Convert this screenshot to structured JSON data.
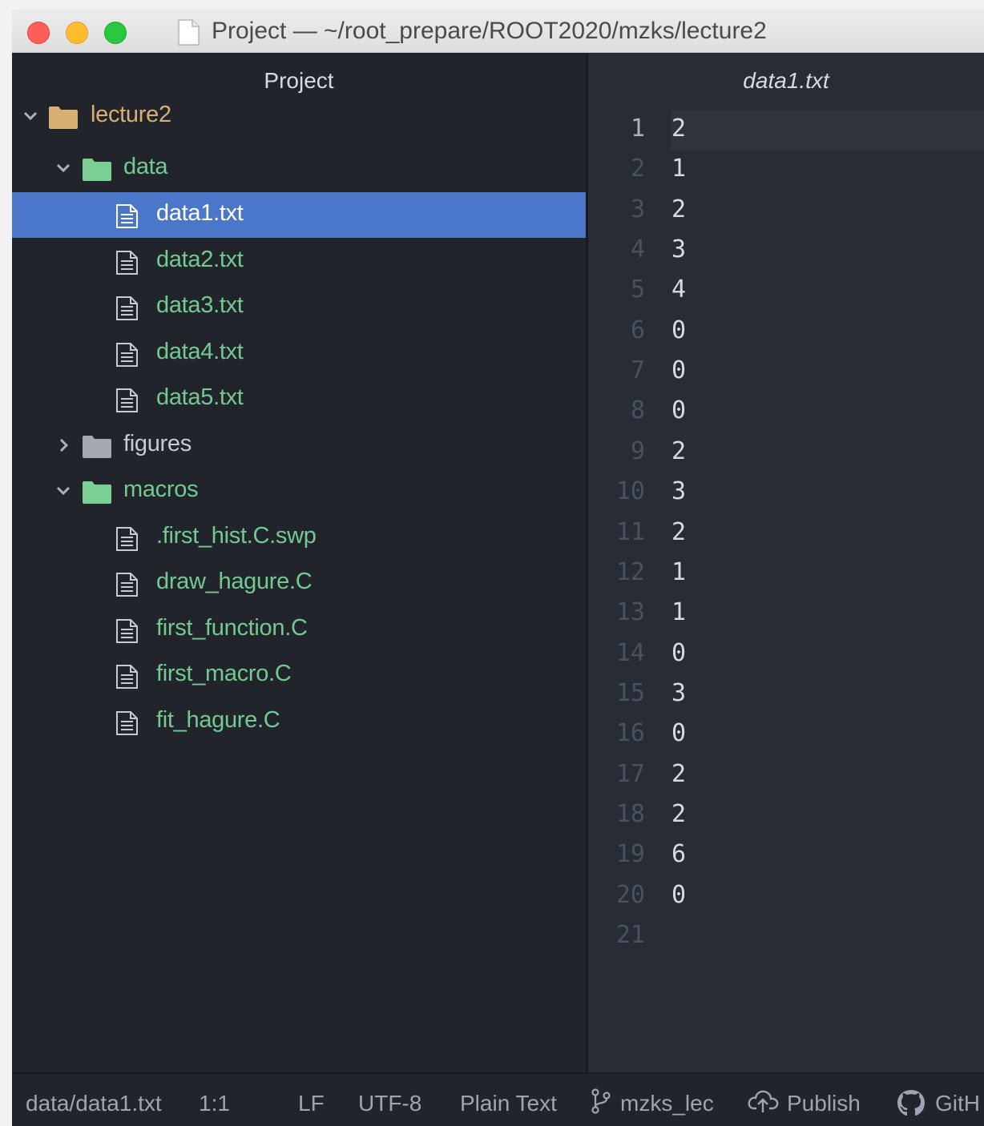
{
  "window": {
    "title": "Project — ~/root_prepare/ROOT2020/mzks/lecture2"
  },
  "sidebar": {
    "title": "Project",
    "tree": [
      {
        "label": "lecture2",
        "kind": "folder",
        "expanded": true,
        "color": "#d9b072",
        "label_color": "#d9b072"
      },
      {
        "label": "data",
        "kind": "folder",
        "expanded": true,
        "color": "#7ccf94",
        "label_color": "#73c991"
      },
      {
        "label": "data1.txt",
        "kind": "file",
        "selected": true,
        "label_color": "#ffffff"
      },
      {
        "label": "data2.txt",
        "kind": "file",
        "label_color": "#73c991"
      },
      {
        "label": "data3.txt",
        "kind": "file",
        "label_color": "#73c991"
      },
      {
        "label": "data4.txt",
        "kind": "file",
        "label_color": "#73c991"
      },
      {
        "label": "data5.txt",
        "kind": "file",
        "label_color": "#73c991"
      },
      {
        "label": "figures",
        "kind": "folder",
        "expanded": false,
        "color": "#a5a9b4",
        "label_color": "#c5cad3"
      },
      {
        "label": "macros",
        "kind": "folder",
        "expanded": true,
        "color": "#7ccf94",
        "label_color": "#73c991"
      },
      {
        "label": ".first_hist.C.swp",
        "kind": "file",
        "label_color": "#73c991"
      },
      {
        "label": "draw_hagure.C",
        "kind": "file",
        "label_color": "#73c991"
      },
      {
        "label": "first_function.C",
        "kind": "file",
        "label_color": "#73c991"
      },
      {
        "label": "first_macro.C",
        "kind": "file",
        "label_color": "#73c991"
      },
      {
        "label": "fit_hagure.C",
        "kind": "file",
        "label_color": "#73c991"
      }
    ]
  },
  "editor": {
    "tab_title": "data1.txt",
    "line_numbers": [
      "1",
      "2",
      "3",
      "4",
      "5",
      "6",
      "7",
      "8",
      "9",
      "10",
      "11",
      "12",
      "13",
      "14",
      "15",
      "16",
      "17",
      "18",
      "19",
      "20",
      "21"
    ],
    "lines": [
      "2",
      "1",
      "2",
      "3",
      "4",
      "0",
      "0",
      "0",
      "2",
      "3",
      "2",
      "1",
      "1",
      "0",
      "3",
      "0",
      "2",
      "2",
      "6",
      "0",
      ""
    ]
  },
  "statusbar": {
    "file_path": "data/data1.txt",
    "cursor_position": "1:1",
    "line_ending": "LF",
    "encoding": "UTF-8",
    "grammar": "Plain Text",
    "branch": "mzks_lec",
    "publish_label": "Publish",
    "github_label": "GitH"
  },
  "colors": {
    "selection": "#4a77c9",
    "vcs_added_green": "#73c991",
    "project_root": "#d9b072"
  },
  "icons": {
    "titlebar_document": "document-icon",
    "folder": "folder-icon",
    "file": "file-text-icon",
    "branch": "git-branch-icon",
    "publish": "cloud-upload-icon",
    "github": "github-icon"
  }
}
